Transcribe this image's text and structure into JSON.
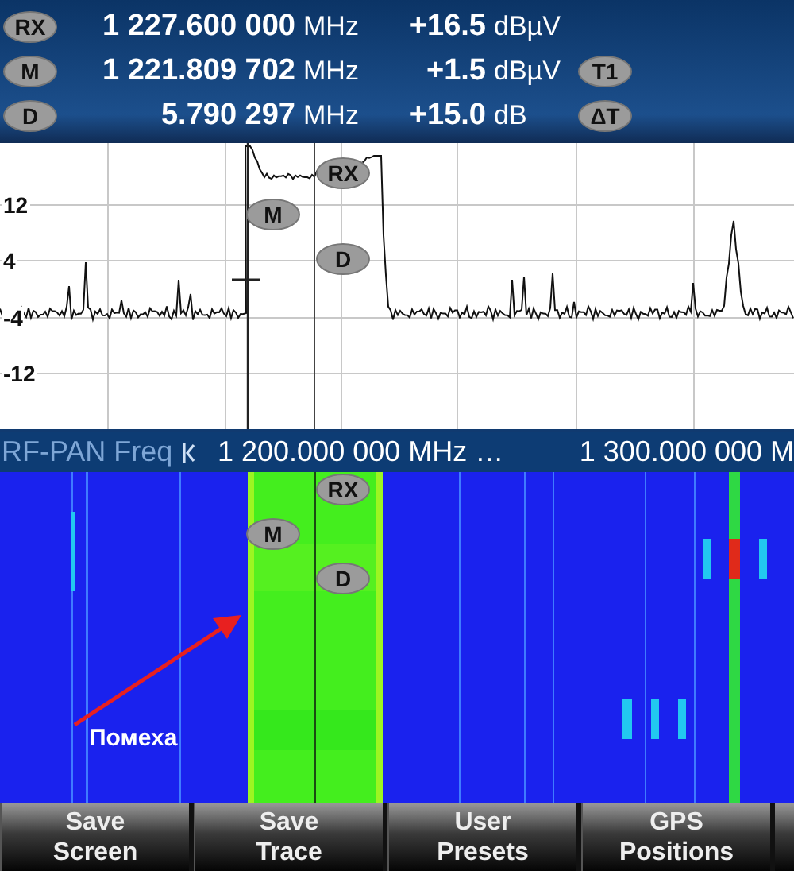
{
  "readouts": [
    {
      "marker": "RX",
      "frequency": "1 227.600 000",
      "frequency_unit": "MHz",
      "level": "+16.5",
      "level_unit": "dBµV"
    },
    {
      "marker": "M",
      "frequency": "1 221.809 702",
      "frequency_unit": "MHz",
      "level": "+1.5",
      "level_unit": "dBµV",
      "tag": "T1"
    },
    {
      "marker": "D",
      "frequency": "5.790 297",
      "frequency_unit": "MHz",
      "level": "+15.0",
      "level_unit": "dB",
      "tag": "ΔT"
    }
  ],
  "spectrum": {
    "y_labels": [
      "12",
      "4",
      "-4",
      "-12"
    ],
    "markers": [
      "RX",
      "M",
      "D"
    ]
  },
  "scale_bar": {
    "mode": "RF-PAN Freq",
    "start": "1 200.000 000 MHz …",
    "stop": "1 300.000 000 M"
  },
  "waterfall": {
    "markers": [
      "RX",
      "M",
      "D"
    ],
    "annotation": "Помеха"
  },
  "softkeys": [
    {
      "lines": [
        "Save",
        "Screen"
      ]
    },
    {
      "lines": [
        "Save",
        "Trace"
      ]
    },
    {
      "lines": [
        "User",
        "Presets"
      ]
    },
    {
      "lines": [
        "GPS",
        "Positions"
      ]
    }
  ]
}
